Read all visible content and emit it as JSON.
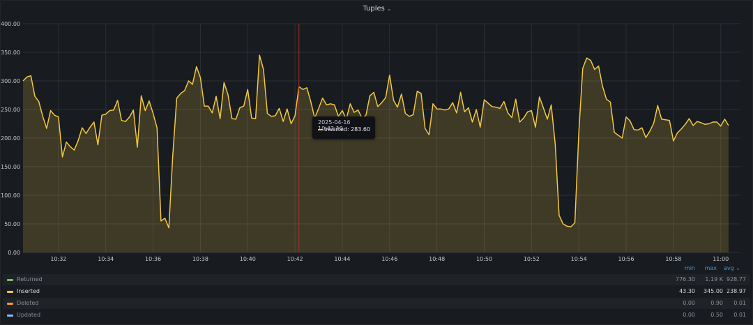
{
  "panel": {
    "title": "Tuples"
  },
  "chart_data": {
    "type": "area",
    "ylim": [
      0,
      400
    ],
    "yticks": [
      "0.00",
      "50.00",
      "100.00",
      "150.00",
      "200.00",
      "250.00",
      "300.00",
      "350.00",
      "400.00"
    ],
    "ytick_values": [
      0,
      50,
      100,
      150,
      200,
      250,
      300,
      350,
      400
    ],
    "xlim": [
      "10:30:30",
      "11:00:50"
    ],
    "xtick_times": [
      "10:32",
      "10:34",
      "10:36",
      "10:38",
      "10:40",
      "10:42",
      "10:44",
      "10:46",
      "10:48",
      "10:50",
      "10:52",
      "10:54",
      "10:56",
      "10:58",
      "11:00"
    ],
    "grid": true,
    "crosshair_time": "10:42:10",
    "series": [
      {
        "name": "Inserted",
        "color": "#f2c742",
        "x_start": "10:30:30",
        "x_step_seconds": 10,
        "values": [
          300,
          307,
          309,
          273,
          264,
          238,
          217,
          248,
          240,
          237,
          167,
          193,
          185,
          179,
          196,
          218,
          208,
          219,
          228,
          188,
          240,
          242,
          248,
          249,
          266,
          231,
          229,
          237,
          249,
          184,
          274,
          248,
          265,
          243,
          218,
          55,
          60,
          43,
          170,
          270,
          278,
          283,
          300,
          294,
          325,
          306,
          256,
          256,
          244,
          273,
          234,
          297,
          276,
          234,
          233,
          253,
          256,
          285,
          235,
          234,
          345,
          320,
          243,
          238,
          239,
          252,
          229,
          251,
          225,
          239,
          290,
          285,
          288,
          264,
          235,
          252,
          270,
          258,
          260,
          258,
          238,
          248,
          233,
          260,
          245,
          249,
          235,
          240,
          274,
          280,
          255,
          262,
          271,
          310,
          266,
          254,
          277,
          243,
          238,
          241,
          282,
          278,
          217,
          206,
          260,
          251,
          251,
          249,
          251,
          262,
          244,
          280,
          246,
          253,
          228,
          250,
          219,
          267,
          261,
          255,
          254,
          252,
          264,
          244,
          236,
          268,
          228,
          235,
          246,
          248,
          219,
          272,
          253,
          233,
          258,
          190,
          65,
          50,
          46,
          45,
          52,
          210,
          322,
          340,
          336,
          320,
          326,
          291,
          268,
          263,
          210,
          205,
          200,
          237,
          230,
          215,
          214,
          218,
          201,
          212,
          226,
          257,
          233,
          232,
          231,
          195,
          209,
          216,
          224,
          234,
          222,
          229,
          227,
          224,
          225,
          228,
          228,
          221,
          233,
          222
        ]
      }
    ]
  },
  "tooltip": {
    "time": "2025-04-16 10:42:10",
    "series": "Inserted:",
    "value": "283.60"
  },
  "legend": {
    "headers": {
      "min": "min",
      "max": "max",
      "avg": "avg ⌄"
    },
    "rows": [
      {
        "name": "Returned",
        "color": "#73bf69",
        "min": "776.30",
        "max": "1.19 K",
        "avg": "928.77"
      },
      {
        "name": "Inserted",
        "color": "#f2c742",
        "min": "43.30",
        "max": "345.00",
        "avg": "238.97"
      },
      {
        "name": "Deleted",
        "color": "#ff9830",
        "min": "0.00",
        "max": "0.90",
        "avg": "0.01"
      },
      {
        "name": "Updated",
        "color": "#8ab8ff",
        "min": "0.00",
        "max": "0.50",
        "avg": "0.01"
      }
    ]
  }
}
